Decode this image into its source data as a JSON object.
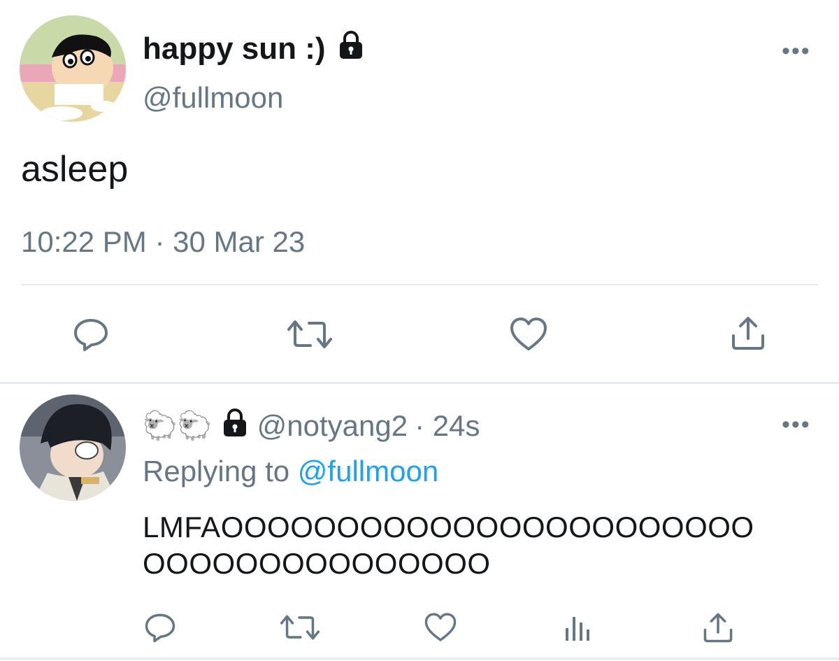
{
  "main_tweet": {
    "display_name": "happy sun :)",
    "handle": "@fullmoon",
    "text": "asleep",
    "timestamp": "10:22 PM · 30 Mar 23",
    "more_label": "•••",
    "locked_icon": "lock-icon",
    "actions": [
      "reply-icon",
      "retweet-icon",
      "like-icon",
      "share-icon"
    ]
  },
  "reply_tweet": {
    "display_name_emoji": "🐑🐑",
    "handle": "@notyang2",
    "age": "· 24s",
    "replying_prefix": "Replying to",
    "replying_to": "@fullmoon",
    "text_line1": "LMFAOOOOOOOOOOOOOOOOOOOOOOO",
    "text_line2": "OOOOOOOOOOOOOOO",
    "more_label": "•••",
    "actions": [
      "reply-icon",
      "retweet-icon",
      "like-icon",
      "analytics-icon",
      "share-icon"
    ]
  },
  "colors": {
    "text": "#14171a",
    "secondary": "#657786",
    "accent": "#1da1f2",
    "divider": "#e6ecf0"
  }
}
